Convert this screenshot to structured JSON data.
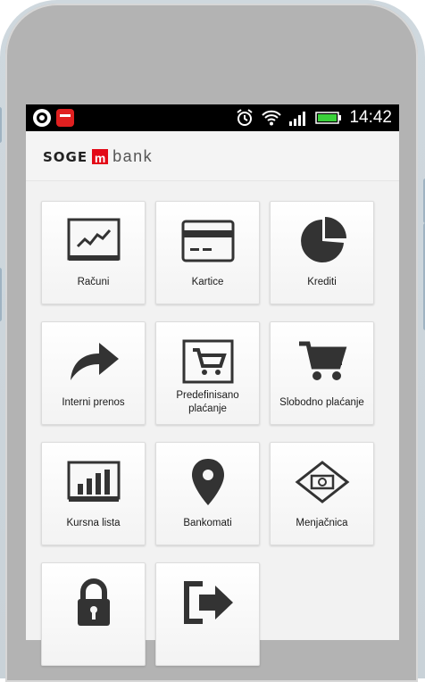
{
  "status_bar": {
    "time": "14:42",
    "left_icons": [
      "app-circle-icon",
      "red-app-icon"
    ],
    "right_icons": [
      "alarm-icon",
      "wifi-icon",
      "signal-icon",
      "battery-icon"
    ]
  },
  "header": {
    "logo": {
      "prefix": "SOGE",
      "m": "m",
      "suffix": "bank"
    }
  },
  "menu": [
    {
      "label": "Računi",
      "icon": "chart-line-icon"
    },
    {
      "label": "Kartice",
      "icon": "card-icon"
    },
    {
      "label": "Krediti",
      "icon": "pie-chart-icon"
    },
    {
      "label": "Interni prenos",
      "icon": "forward-arrow-icon"
    },
    {
      "label": "Predefinisano plaćanje",
      "icon": "framed-cart-icon"
    },
    {
      "label": "Slobodno plaćanje",
      "icon": "cart-icon"
    },
    {
      "label": "Kursna lista",
      "icon": "bar-chart-icon"
    },
    {
      "label": "Bankomati",
      "icon": "location-pin-icon"
    },
    {
      "label": "Menjačnica",
      "icon": "exchange-icon"
    },
    {
      "label": "",
      "icon": "lock-icon"
    },
    {
      "label": "",
      "icon": "logout-icon"
    }
  ],
  "colors": {
    "brand_red": "#e30a17",
    "statusbar": "#000000",
    "tile_text": "#1a1a1a"
  }
}
